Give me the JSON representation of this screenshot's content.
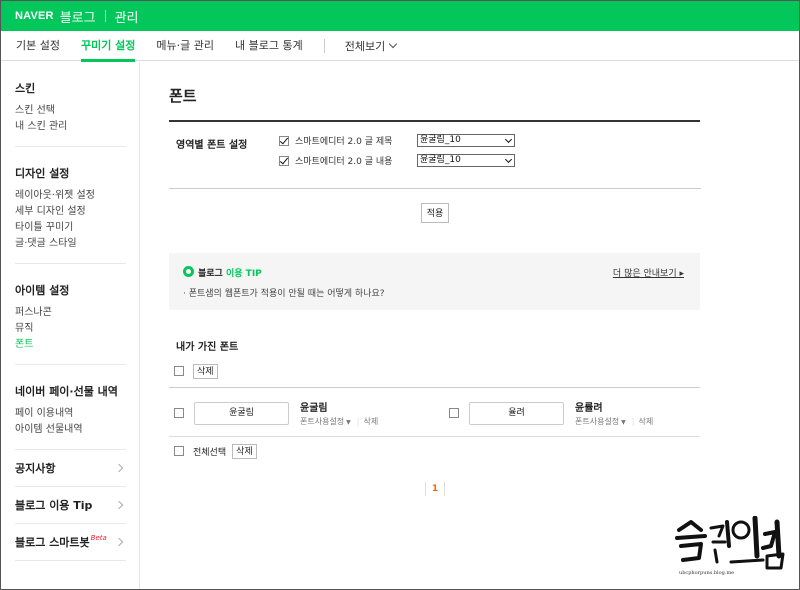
{
  "topbar": {
    "brand": "NAVER",
    "blog": "블로그",
    "manage": "관리"
  },
  "nav": {
    "tabs": [
      {
        "label": "기본 설정",
        "active": false
      },
      {
        "label": "꾸미기 설정",
        "active": true
      },
      {
        "label": "메뉴·글 관리",
        "active": false
      },
      {
        "label": "내 블로그 통계",
        "active": false
      }
    ],
    "all_label": "전체보기"
  },
  "sidebar": {
    "groups": [
      {
        "title": "스킨",
        "items": [
          "스킨 선택",
          "내 스킨 관리"
        ]
      },
      {
        "title": "디자인 설정",
        "items": [
          "레이아웃·위젯 설정",
          "세부 디자인 설정",
          "타이틀 꾸미기",
          "글·댓글 스타일"
        ]
      },
      {
        "title": "아이템 설정",
        "items": [
          "퍼스나콘",
          "뮤직",
          "폰트"
        ]
      },
      {
        "title": "네이버 페이·선물 내역",
        "items": [
          "페이 이용내역",
          "아이템 선물내역"
        ]
      }
    ],
    "links": [
      "공지사항",
      "블로그 이용 Tip",
      "블로그 스마트봇"
    ],
    "beta": "Beta"
  },
  "page": {
    "title": "폰트"
  },
  "font_settings": {
    "label": "영역별 폰트 설정",
    "rows": [
      {
        "label": "스마트에디터 2.0 글 제목",
        "checked": true,
        "value": "윤굴림_10"
      },
      {
        "label": "스마트에디터 2.0 글 내용",
        "checked": true,
        "value": "윤굴림_10"
      }
    ],
    "apply": "적용"
  },
  "tip": {
    "title_a": "블로그",
    "title_b": "이용 TIP",
    "more": "더 많은 안내보기",
    "text": "· 폰트샘의 웹폰트가 적용이 안될 때는 어떻게 하나요?"
  },
  "my_fonts": {
    "title": "내가 가진 폰트",
    "delete": "삭제",
    "items": [
      {
        "preview": "윤굴림",
        "name": "윤굴림",
        "setting": "폰트사용설정",
        "delete": "삭제"
      },
      {
        "preview": "율려",
        "name": "윤률려",
        "setting": "폰트사용설정",
        "delete": "삭제"
      }
    ],
    "select_all": "전체선택",
    "page": "1"
  },
  "watermark": {
    "sub": "ubcphorpuns.blog.me"
  },
  "colors": {
    "brand": "#03c75a",
    "pager": "#ff6600"
  }
}
